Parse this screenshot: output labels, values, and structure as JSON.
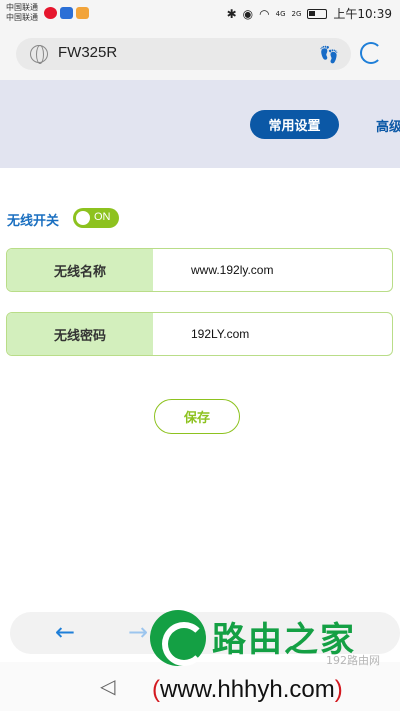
{
  "status_bar": {
    "carrier_1": "中国联通",
    "carrier_2": "中国联通",
    "network_1": "4G",
    "network_2": "2G",
    "time": "上午10:39"
  },
  "browser": {
    "url": "FW325R"
  },
  "tabs": {
    "common_settings": "常用设置",
    "advanced": "高级"
  },
  "wireless": {
    "switch_label": "无线开关",
    "switch_state": "ON",
    "name_label": "无线名称",
    "name_value": "www.192ly.com",
    "password_label": "无线密码",
    "password_value": "192LY.com",
    "save_label": "保存"
  },
  "watermark": {
    "title": "路由之家",
    "site": "192路由网",
    "url_open": "(",
    "url": "www.hhhyh.com",
    "url_close": ")"
  },
  "colors": {
    "accent_blue": "#0b58a6",
    "toggle_green": "#8dc21f",
    "label_bg": "#d3efbd"
  }
}
